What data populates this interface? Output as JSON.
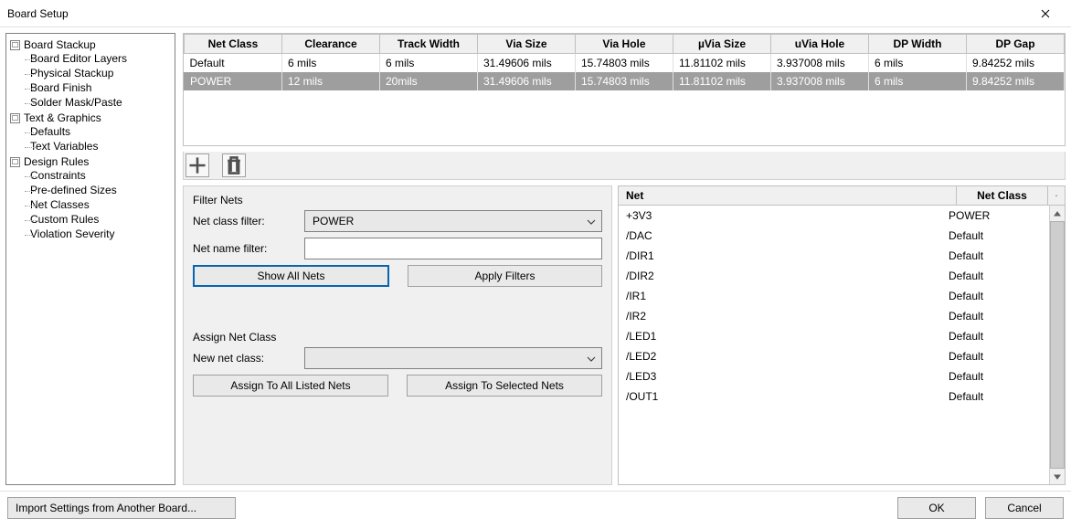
{
  "window": {
    "title": "Board Setup"
  },
  "tree": {
    "groups": [
      {
        "label": "Board Stackup",
        "items": [
          "Board Editor Layers",
          "Physical Stackup",
          "Board Finish",
          "Solder Mask/Paste"
        ]
      },
      {
        "label": "Text & Graphics",
        "items": [
          "Defaults",
          "Text Variables"
        ]
      },
      {
        "label": "Design Rules",
        "items": [
          "Constraints",
          "Pre-defined Sizes",
          "Net Classes",
          "Custom Rules",
          "Violation Severity"
        ]
      }
    ]
  },
  "netclass_table": {
    "headers": [
      "Net Class",
      "Clearance",
      "Track Width",
      "Via Size",
      "Via Hole",
      "µVia Size",
      "uVia Hole",
      "DP Width",
      "DP Gap"
    ],
    "rows": [
      {
        "cells": [
          "Default",
          "6 mils",
          "6 mils",
          "31.49606 mils",
          "15.74803 mils",
          "11.81102 mils",
          "3.937008 mils",
          "6 mils",
          "9.84252 mils"
        ],
        "selected": false
      },
      {
        "cells": [
          "POWER",
          "12 mils",
          "20mils",
          "31.49606 mils",
          "15.74803 mils",
          "11.81102 mils",
          "3.937008 mils",
          "6 mils",
          "9.84252 mils"
        ],
        "selected": true
      }
    ]
  },
  "filter": {
    "section_label": "Filter Nets",
    "class_filter_label": "Net class filter:",
    "class_filter_value": "POWER",
    "name_filter_label": "Net name filter:",
    "name_filter_value": "",
    "show_all_btn": "Show All Nets",
    "apply_btn": "Apply Filters"
  },
  "assign": {
    "section_label": "Assign Net Class",
    "new_class_label": "New net class:",
    "new_class_value": "",
    "assign_all_btn": "Assign To All Listed Nets",
    "assign_sel_btn": "Assign To Selected Nets"
  },
  "nets_table": {
    "headers": {
      "net": "Net",
      "cls": "Net Class"
    },
    "rows": [
      {
        "net": "+3V3",
        "cls": "POWER"
      },
      {
        "net": "/DAC",
        "cls": "Default"
      },
      {
        "net": "/DIR1",
        "cls": "Default"
      },
      {
        "net": "/DIR2",
        "cls": "Default"
      },
      {
        "net": "/IR1",
        "cls": "Default"
      },
      {
        "net": "/IR2",
        "cls": "Default"
      },
      {
        "net": "/LED1",
        "cls": "Default"
      },
      {
        "net": "/LED2",
        "cls": "Default"
      },
      {
        "net": "/LED3",
        "cls": "Default"
      },
      {
        "net": "/OUT1",
        "cls": "Default"
      }
    ]
  },
  "footer": {
    "import_btn": "Import Settings from Another Board...",
    "ok_btn": "OK",
    "cancel_btn": "Cancel"
  }
}
